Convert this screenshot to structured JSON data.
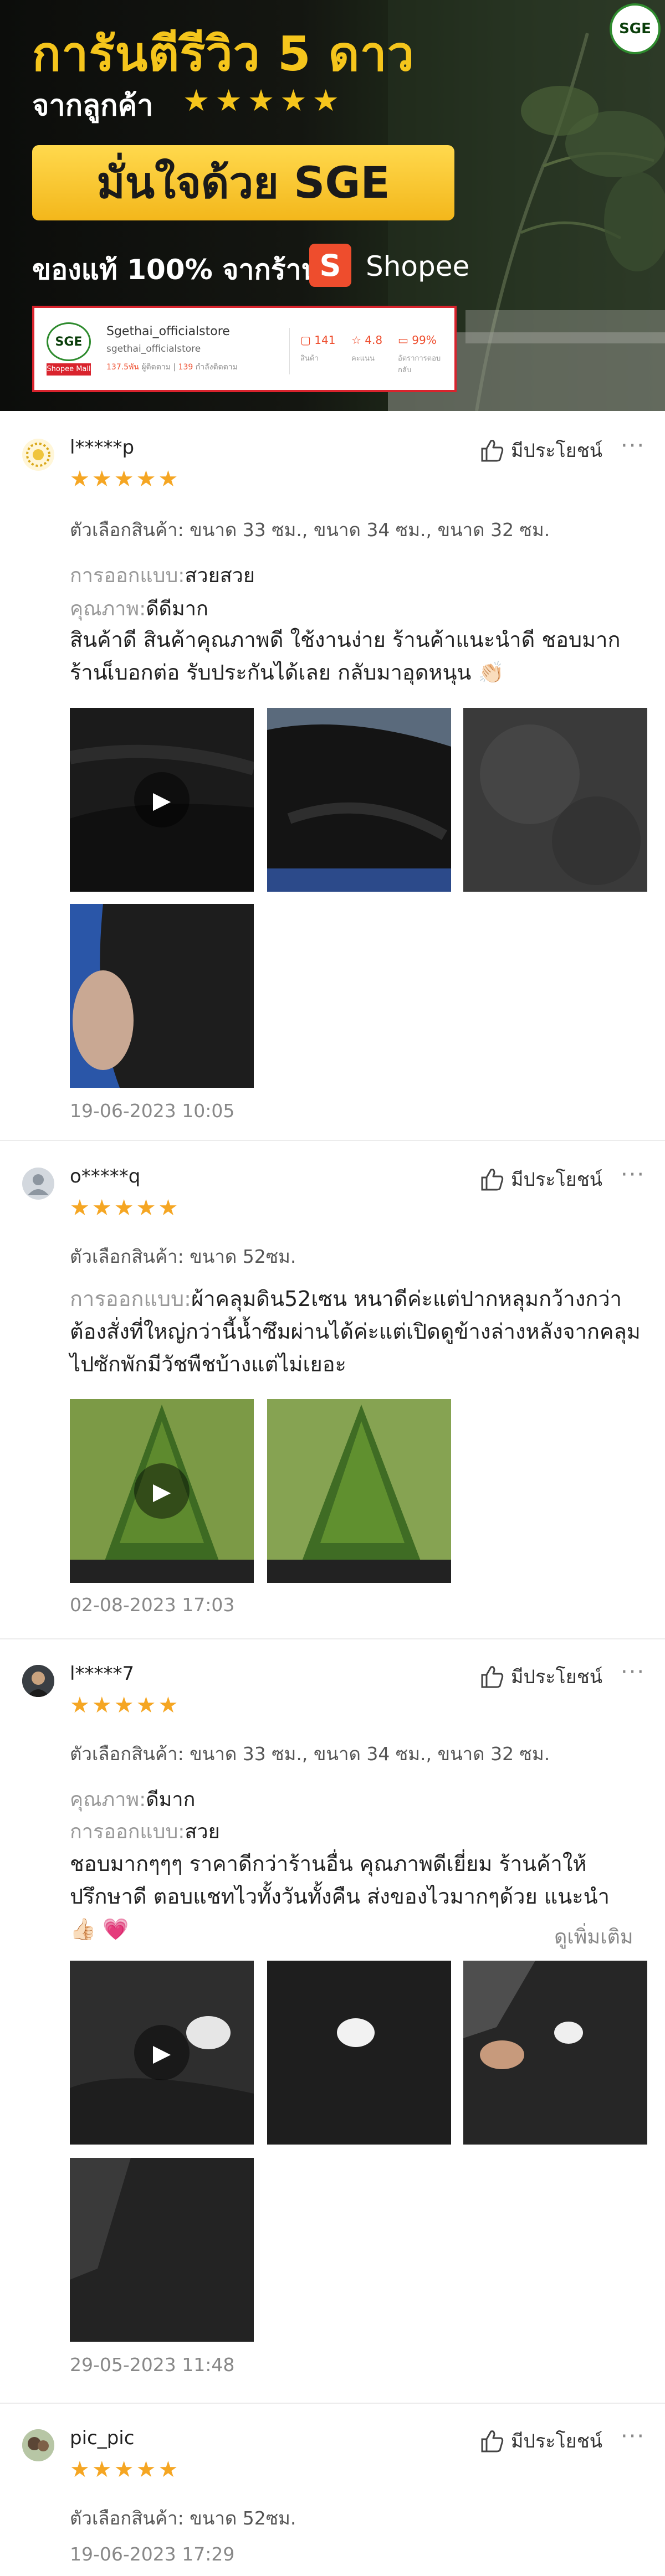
{
  "banner": {
    "headline": "การันตีรีวิว 5 ดาว",
    "subhead": "จากลูกค้า",
    "stars": "★★★★★",
    "cta": "มั่นใจด้วย SGE",
    "authentic": "ของแท้ 100% จากร้าน",
    "shopee_label": "Shopee",
    "shopee_icon": "shopee-bag-icon",
    "brand_logo": "SGE",
    "store": {
      "name": "Sgethai_officialstore",
      "id": "sgethai_officialstore",
      "meta_followers": "137.5พัน",
      "meta_followers_label": "ผู้ติดตาม",
      "meta_following": "139",
      "meta_following_label": "กำลังติดตาม",
      "logo_tag": "Shopee Mall",
      "stats": [
        {
          "value": "141",
          "label": "สินค้า",
          "icon": "box-icon"
        },
        {
          "value": "4.8",
          "label": "คะแนน",
          "icon": "star-icon"
        },
        {
          "value": "99%",
          "label": "อัตราการตอบกลับ",
          "icon": "chat-icon"
        }
      ]
    }
  },
  "common": {
    "helpful": "มีประโยชน์",
    "more": "···",
    "stars": "★★★★★"
  },
  "reviews": [
    {
      "username": "l*****p",
      "variation": "ตัวเลือกสินค้า: ขนาด 33 ซม., ขนาด 34 ซม., ขนาด 32 ซม.",
      "attr1_key": "การออกแบบ:",
      "attr1_val": "สวยสวย",
      "attr2_key": "คุณภาพ:",
      "attr2_val": "ดีดีมาก",
      "text": "สินค้าดี สินค้าคุณภาพดี ใช้งานง่าย ร้านค้าแนะนำดี ชอบมาก ร้านเ็บอกต่อ รับประกันได้เลย กลับมาอุดหนุน 👏🏻",
      "date": "19-06-2023 10:05"
    },
    {
      "username": "o*****q",
      "variation": "ตัวเลือกสินค้า: ขนาด 52ซม.",
      "text_key": "การออกแบบ:",
      "text": "ผ้าคลุมดิน52เซน หนาดีค่ะแต่ปากหลุมกว้างกว่าต้องสั่งที่ใหญ่กว่านี้น้ำซึมผ่านได้ค่ะแต่เปิดดูข้างล่างหลังจากคลุมไปซักพักมีวัชพืชบ้างแต่ไม่เยอะ",
      "date": "02-08-2023 17:03"
    },
    {
      "username": "l*****7",
      "variation": "ตัวเลือกสินค้า: ขนาด 33 ซม., ขนาด 34 ซม., ขนาด 32 ซม.",
      "attr1_key": "คุณภาพ:",
      "attr1_val": "ดีมาก",
      "attr2_key": "การออกแบบ:",
      "attr2_val": "สวย",
      "text": "ชอบมากๆๆๆ ราคาดีกว่าร้านอื่น คุณภาพดีเยี่ยม ร้านค้าให้ปรึกษาดี ตอบแชทไวทั้งวันทั้งคืน ส่งของไวมากๆด้วย แนะนำ 👍🏻 💗",
      "see_more": "ดูเพิ่มเติม",
      "date": "29-05-2023 11:48"
    },
    {
      "username": "pic_pic",
      "variation": "ตัวเลือกสินค้า: ขนาด 52ซม.",
      "date": "19-06-2023 17:29"
    }
  ]
}
